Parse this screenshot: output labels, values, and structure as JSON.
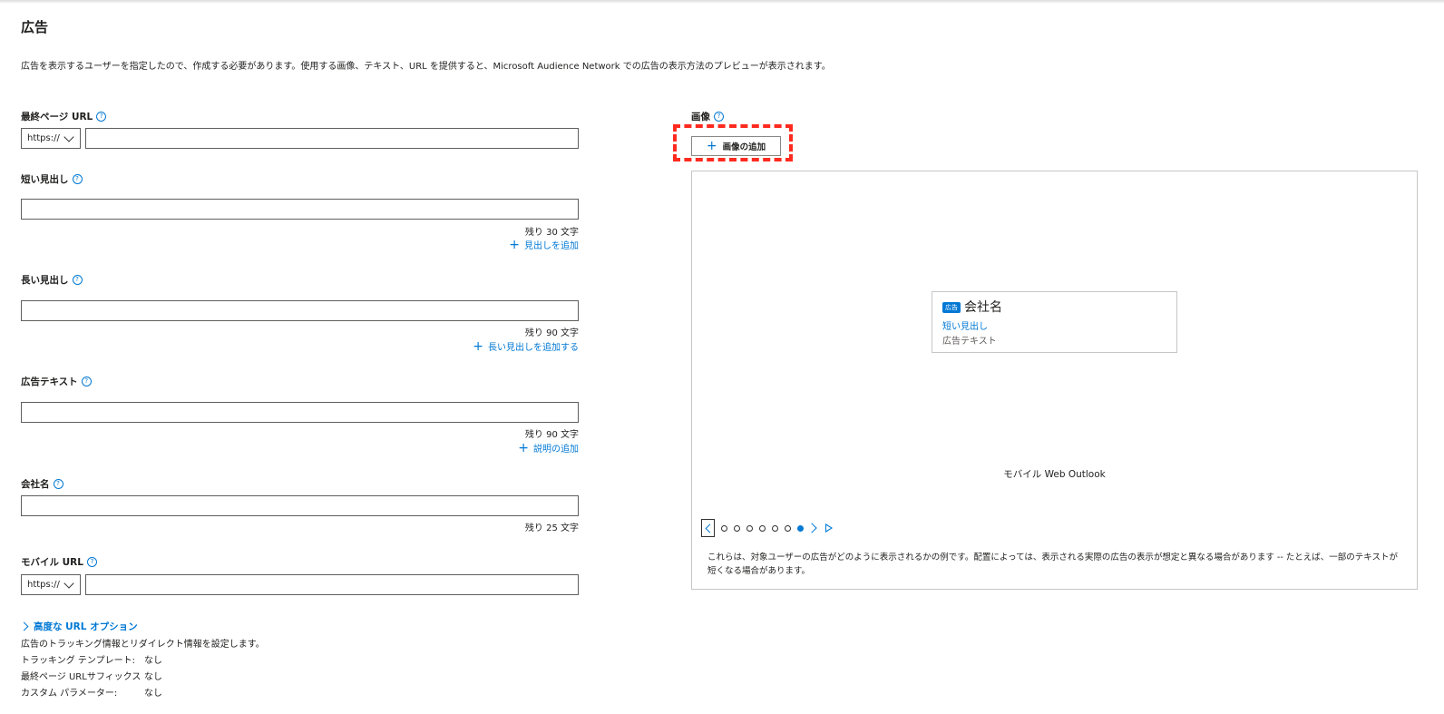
{
  "header": {
    "title": "広告",
    "description": "広告を表示するユーザーを指定したので、作成する必要があります。使用する画像、テキスト、URL を提供すると、Microsoft Audience Network での広告の表示方法のプレビューが表示されます。"
  },
  "form": {
    "final_url": {
      "label": "最終ページ URL",
      "protocol": "https://",
      "value": ""
    },
    "short_headline": {
      "label": "短い見出し",
      "value": "",
      "remaining": "残り 30 文字",
      "add_link": "見出しを追加"
    },
    "long_headline": {
      "label": "長い見出し",
      "value": "",
      "remaining": "残り 90 文字",
      "add_link": "長い見出しを追加する"
    },
    "ad_text": {
      "label": "広告テキスト",
      "value": "",
      "remaining": "残り 90 文字",
      "add_link": "説明の追加"
    },
    "company_name": {
      "label": "会社名",
      "value": "",
      "remaining": "残り 25 文字"
    },
    "mobile_url": {
      "label": "モバイル URL",
      "protocol": "https://",
      "value": ""
    },
    "help_glyph": "?"
  },
  "advanced": {
    "toggle_label": "高度な URL オプション",
    "description": "広告のトラッキング情報とリダイレクト情報を設定します。",
    "rows": [
      {
        "key": "トラッキング テンプレート:",
        "value": "なし"
      },
      {
        "key": "最終ページ URLサフィックス",
        "value": "なし"
      },
      {
        "key": "カスタム パラメーター:",
        "value": "なし"
      }
    ]
  },
  "images": {
    "label": "画像",
    "add_button": "画像の追加"
  },
  "preview": {
    "ad_badge": "広告",
    "company": "会社名",
    "headline": "短い見出し",
    "text": "広告テキスト",
    "platform": "モバイル Web Outlook",
    "dots_total": 7,
    "active_dot": 7,
    "note": "これらは、対象ユーザーの広告がどのように表示されるかの例です。配置によっては、表示される実際の広告の表示が想定と異なる場合があります -- たとえば、一部のテキストが短くなる場合があります。"
  },
  "colors": {
    "accent": "#0078d4",
    "highlight": "#ff2a1f"
  }
}
